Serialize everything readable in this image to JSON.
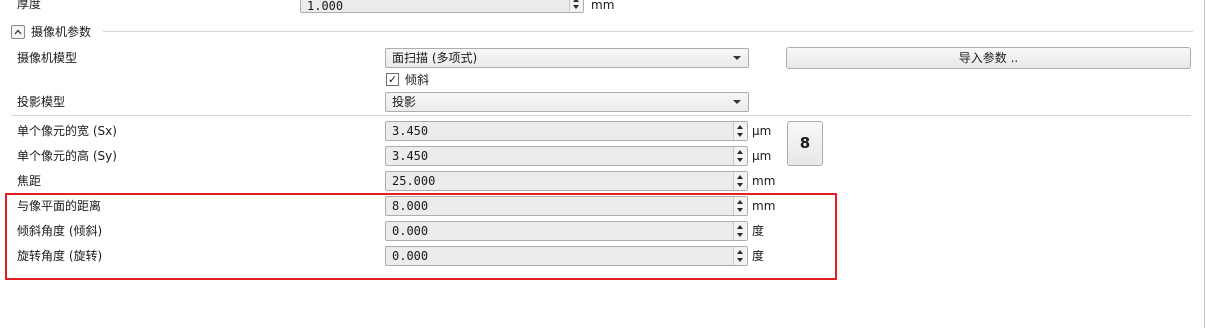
{
  "thickness": {
    "label": "厚度",
    "value": "1.000",
    "unit": "mm"
  },
  "camera_section": {
    "title": "摄像机参数"
  },
  "camera_model": {
    "label": "摄像机模型",
    "value": "面扫描 (多项式)"
  },
  "tilt": {
    "label": "倾斜",
    "checked": true,
    "check_glyph": "✓"
  },
  "import_button": {
    "label": "导入参数 .."
  },
  "projection_model": {
    "label": "投影模型",
    "value": "投影"
  },
  "pixel_width": {
    "label": "单个像元的宽 (Sx)",
    "value": "3.450",
    "unit": "μm"
  },
  "pixel_height": {
    "label": "单个像元的高 (Sy)",
    "value": "3.450",
    "unit": "μm"
  },
  "link_button": {
    "icon": "chain-link-icon",
    "glyph": "8"
  },
  "focal_length": {
    "label": "焦距",
    "value": "25.000",
    "unit": "mm"
  },
  "image_plane_distance": {
    "label": "与像平面的距离",
    "value": "8.000",
    "unit": "mm"
  },
  "tilt_angle": {
    "label": "倾斜角度 (倾斜)",
    "value": "0.000",
    "unit": "度"
  },
  "rotation_angle": {
    "label": "旋转角度 (旋转)",
    "value": "0.000",
    "unit": "度"
  },
  "colors": {
    "highlight_border": "#e02020",
    "field_bg": "#ececec"
  }
}
